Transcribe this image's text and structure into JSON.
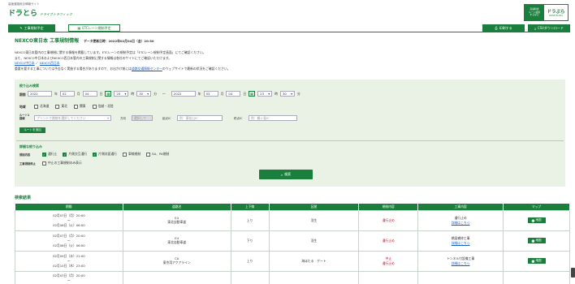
{
  "header": {
    "tagline": "高速道路総合情報サイト",
    "logo_main": "ドラとら",
    "logo_sub": "ドライブトラフィック",
    "right_banner_line1": "高速料金",
    "right_banner_line2": "ルート検索",
    "right_banner_line3": "するなら",
    "right_logo": "ドラぷら",
    "right_logo_sub": "DRIVE PLAZA"
  },
  "tabs": {
    "construction": "工事規制予定",
    "etc_lane": "ETCレーン規制予定",
    "print": "印刷する",
    "csv": "CSVダウンロード"
  },
  "title": {
    "main": "NEXCO東日本 工事規制情報",
    "update_label": "データ更新日時：2022年02月04日（金）20:30"
  },
  "intro": {
    "line1": "NEXCO東日本管内の工事規制に関する情報を掲載しています。ETCレーンの規制予定は「ETCレーン規制予定画面」にてご確認ください。",
    "line2": "また、NEXCO中日本およびNEXCO西日本管内の工事規制に関する情報は各社のサイトにてご確認いただけます。",
    "link_central": "NEXCO中日本",
    "link_sep": "／",
    "link_west": "NEXCO西日本",
    "line3_prefix": "重要を要する工事については予告なく実施する場合がありますので、お出かけ前には",
    "line3_link": "道路交通情報センター",
    "line3_suffix": "のウェブサイトで最新の状況をご確認ください。"
  },
  "filter": {
    "heading": "絞り込み検索",
    "period_label": "期間",
    "start": {
      "year": "2022",
      "month": "02",
      "day": "04",
      "hour": "20",
      "minute": "30"
    },
    "end": {
      "year": "2022",
      "month": "03",
      "day": "04",
      "hour": "23",
      "minute": "30"
    },
    "unit_year": "年",
    "unit_month": "月",
    "unit_day": "日",
    "unit_hour": "時",
    "unit_minute": "分",
    "tilde": "〜",
    "region_label": "地域",
    "regions": [
      "北海道",
      "東北",
      "関東",
      "信越・北陸"
    ],
    "route_label": "ルート1\n路線",
    "route_placeholder": "プリントで路線を選択してください",
    "direction_label": "方向",
    "direction_value": "選択して",
    "start_ic_label": "起点IC",
    "start_ic_placeholder": "例：東松山IC",
    "end_ic_label": "終点IC",
    "end_ic_placeholder": "例：鶴ヶ島IC",
    "add_route": "ルートを追加"
  },
  "detail": {
    "heading": "詳細な絞り込み",
    "content_label": "規制内容",
    "options": [
      {
        "label": "通行止",
        "checked": true
      },
      {
        "label": "片側交互通行",
        "checked": true
      },
      {
        "label": "片側対面通行",
        "checked": true
      },
      {
        "label": "車線規制",
        "checked": false
      },
      {
        "label": "SA、PA規制",
        "checked": false
      }
    ],
    "stop_label": "工事規制停止",
    "stop_option": "中止の工事規制のみ表示",
    "search_button": "検索"
  },
  "results": {
    "heading": "検索結果",
    "columns": [
      "期間",
      "道路名",
      "上下線",
      "区間",
      "規制内容",
      "工事内容",
      "マップ"
    ],
    "rows": [
      {
        "start": "02月07日（月）20:00",
        "tilde": "〜",
        "end": "02月08日（火）06:00",
        "road_code": "E4",
        "road_name": "東北自動車道",
        "direction": "上り",
        "section": "羽生",
        "regulation": "通行止め",
        "work": "通行止め",
        "work_link": "詳細はこちら",
        "map": "地図"
      },
      {
        "start": "02月07日（月）20:00",
        "tilde": "〜",
        "end": "02月08日（火）06:00",
        "road_code": "E4",
        "road_name": "東北自動車道",
        "direction": "下り",
        "section": "羽生",
        "regulation": "通行止め",
        "work": "橋梁補修工事",
        "work_link": "詳細はこちら",
        "map": "地図"
      },
      {
        "start": "02月09日（水）21:00",
        "tilde": "〜",
        "end": "02月10日（木）23:00",
        "road_code": "CA",
        "road_name": "東京湾アクアライン",
        "direction": "上り",
        "section": "海ほたる　ゲート",
        "regulation": "中止",
        "regulation2": "通行止め",
        "work": "トンネル付設備工事",
        "work_link": "詳細はこちら",
        "map": "地図"
      },
      {
        "start": "02月07日（月）20:00",
        "tilde": "〜",
        "end": "",
        "road_code": "",
        "road_name": "",
        "direction": "",
        "section": "",
        "regulation": "",
        "work": "",
        "work_link": "",
        "map": ""
      }
    ]
  },
  "colors": {
    "brand": "#1a7f3c",
    "panel": "#eaf2e6",
    "stop": "#d0021b",
    "link": "#1a5fc8"
  }
}
